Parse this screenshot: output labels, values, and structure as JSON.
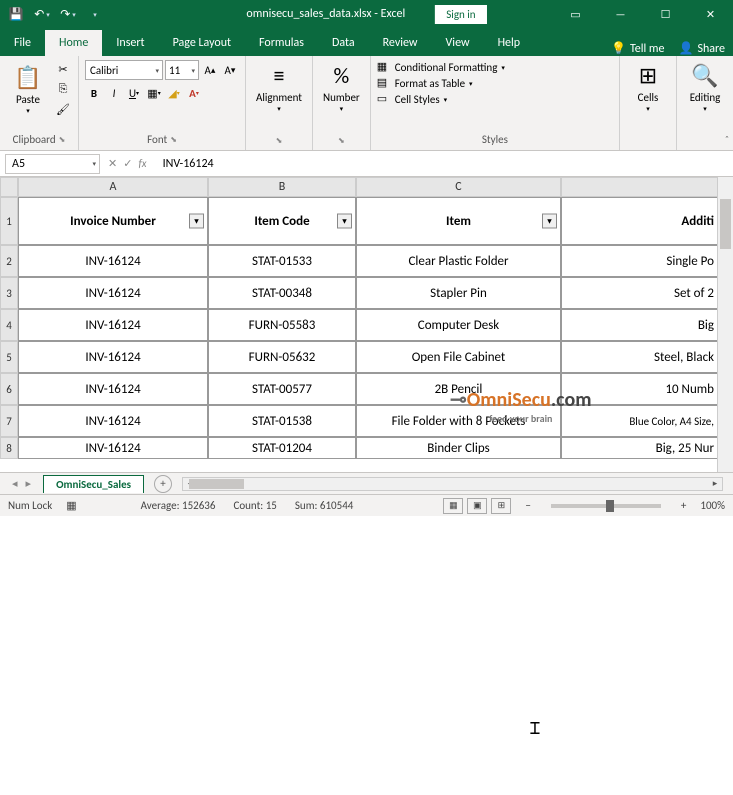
{
  "titlebar": {
    "filename": "omnisecu_sales_data.xlsx - Excel",
    "signin_label": "Sign in"
  },
  "tabs": [
    "File",
    "Home",
    "Insert",
    "Page Layout",
    "Formulas",
    "Data",
    "Review",
    "View",
    "Help"
  ],
  "ribbon_right": {
    "tellme": "Tell me",
    "share": "Share"
  },
  "ribbon": {
    "clipboard": {
      "paste": "Paste",
      "label": "Clipboard"
    },
    "font": {
      "name": "Calibri",
      "size": "11",
      "label": "Font"
    },
    "alignment": {
      "btn": "Alignment"
    },
    "number": {
      "btn": "Number"
    },
    "styles": {
      "cond_fmt": "Conditional Formatting",
      "fmt_table": "Format as Table",
      "cell_styles": "Cell Styles",
      "label": "Styles"
    },
    "cells": {
      "btn": "Cells"
    },
    "editing": {
      "btn": "Editing"
    }
  },
  "formula_bar": {
    "namebox": "A5",
    "formula": "INV-16124"
  },
  "grid": {
    "columns": [
      "A",
      "B",
      "C"
    ],
    "col_d_partial": "Additi",
    "headers": [
      "Invoice Number",
      "Item Code",
      "Item"
    ],
    "rows": [
      {
        "n": "1"
      },
      {
        "n": "2",
        "a": "INV-16124",
        "b": "STAT-01533",
        "c": "Clear Plastic Folder",
        "d": "Single Po"
      },
      {
        "n": "3",
        "a": "INV-16124",
        "b": "STAT-00348",
        "c": "Stapler Pin",
        "d": "Set of 2"
      },
      {
        "n": "4",
        "a": "INV-16124",
        "b": "FURN-05583",
        "c": "Computer Desk",
        "d": "Big"
      },
      {
        "n": "5",
        "a": "INV-16124",
        "b": "FURN-05632",
        "c": "Open File Cabinet",
        "d": "Steel, Black"
      },
      {
        "n": "6",
        "a": "INV-16124",
        "b": "STAT-00577",
        "c": "2B Pencil",
        "d": "10 Numb"
      },
      {
        "n": "7",
        "a": "INV-16124",
        "b": "STAT-01538",
        "c": "File Folder with 8 Pockets",
        "d": "Blue Color, A4 Size,"
      },
      {
        "n": "8",
        "a": "INV-16124",
        "b": "STAT-01204",
        "c": "Binder Clips",
        "d": "Big, 25 Nur"
      }
    ]
  },
  "sheet": {
    "name": "OmniSecu_Sales"
  },
  "status": {
    "numlock": "Num Lock",
    "avg": "Average: 152636",
    "count": "Count: 15",
    "sum": "Sum: 610544",
    "zoom": "100%"
  },
  "watermark": {
    "brand": "OmniSecu",
    "tld": ".com",
    "tagline": "feed your brain"
  }
}
